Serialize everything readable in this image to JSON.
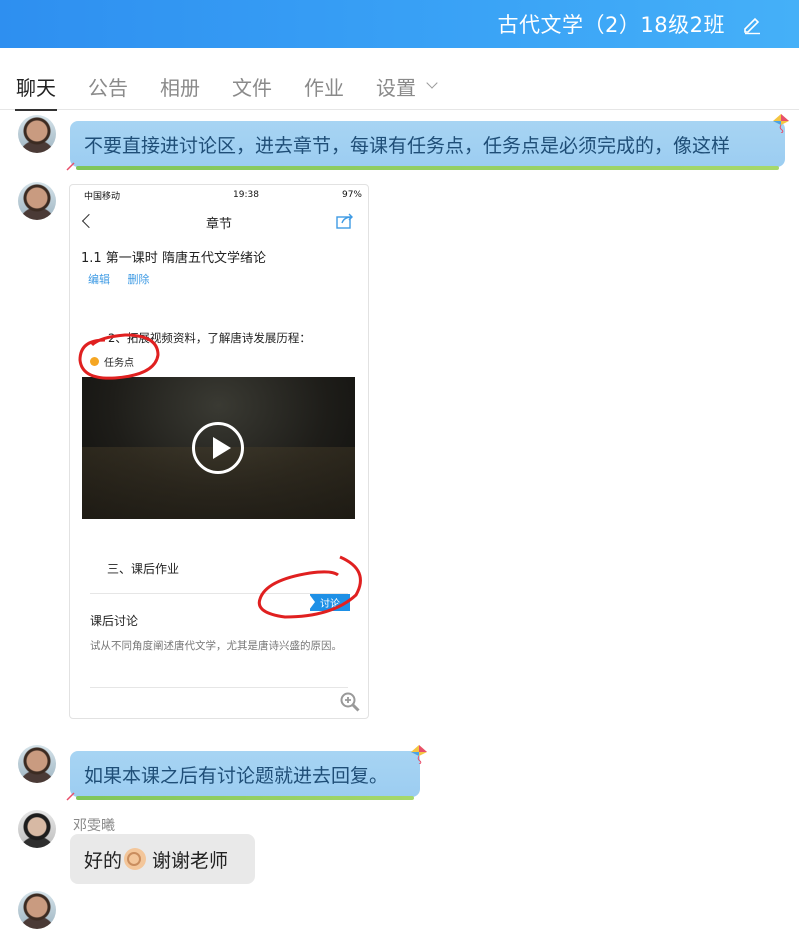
{
  "header": {
    "title": "古代文学（2）18级2班"
  },
  "tabs": [
    {
      "label": "聊天"
    },
    {
      "label": "公告"
    },
    {
      "label": "相册"
    },
    {
      "label": "文件"
    },
    {
      "label": "作业"
    },
    {
      "label": "设置"
    }
  ],
  "messages": {
    "m1": "不要直接进讨论区，进去章节，每课有任务点，任务点是必须完成的，像这样",
    "m3": "如果本课之后有讨论题就进去回复。",
    "reply_sender": "邓雯曦",
    "reply_text_a": "好的",
    "reply_text_b": "谢谢老师"
  },
  "screenshot": {
    "status_carrier": "中国移动",
    "status_time": "19:38",
    "status_battery": "97%",
    "nav_title": "章节",
    "section_title": "1.1 第一课时   隋唐五代文学绪论",
    "op_edit": "编辑",
    "op_delete": "删除",
    "item2": "2、拓展视频资料，了解唐诗发展历程：",
    "task_label": "任务点",
    "homework": "三、课后作业",
    "discuss_tag": "讨论",
    "after_title": "课后讨论",
    "after_desc": "试从不同角度阐述唐代文学，尤其是唐诗兴盛的原因。"
  },
  "colors": {
    "header": "#3aa3f6",
    "bubble": "#a7d4f3",
    "bubble_underline": "#7fc55a",
    "link": "#3f9be4",
    "annotation": "#e02020"
  }
}
